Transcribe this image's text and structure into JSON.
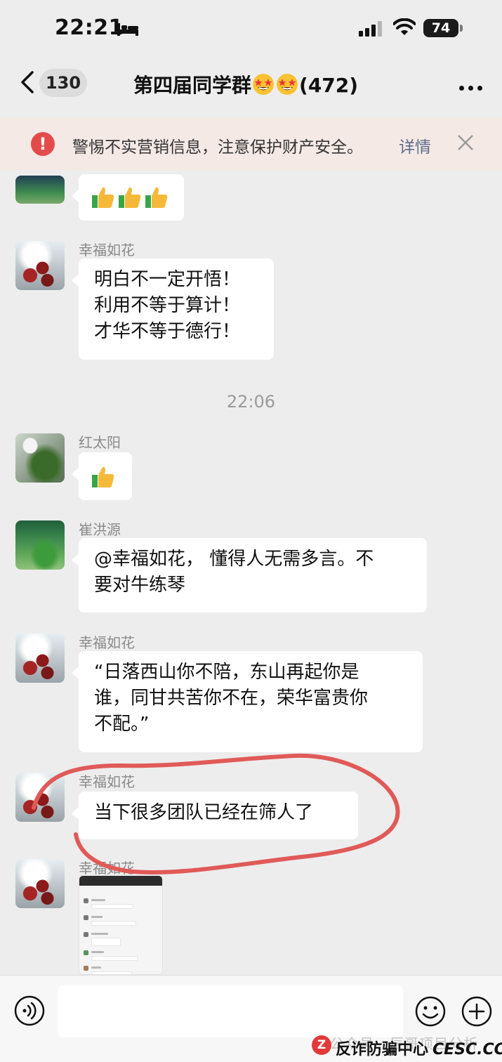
{
  "status_bar": {
    "time": "22:21",
    "battery": "74"
  },
  "nav": {
    "unread_count": "130",
    "group_name": "第四届同学群",
    "member_count": "(472)"
  },
  "warning": {
    "message": "警惕不实营销信息，注意保护财产安全。",
    "detail_link": "详情"
  },
  "messages": [
    {
      "sender": "幸福如花",
      "lines": [
        "明白不一定开悟！",
        "利用不等于算计！",
        "才华不等于德行！"
      ]
    },
    {
      "sender": "红太阳",
      "content": "thumbs-up-emoji"
    },
    {
      "sender": "崔洪源",
      "lines": [
        "@幸福如花， 懂得人无需多言。不",
        "要对牛练琴"
      ]
    },
    {
      "sender": "幸福如花",
      "lines": [
        "“日落西山你不陪，东山再起你是",
        "谁，同甘共苦你不在，荣华富贵你",
        "不配。”"
      ]
    },
    {
      "sender": "幸福如花",
      "lines": [
        "当下很多团队已经在筛人了"
      ]
    },
    {
      "sender": "幸福如花",
      "content": "screenshot-image"
    }
  ],
  "timestamp": "22:06",
  "top_message": {
    "content": "thumbs-up-x3"
  },
  "input": {
    "placeholder": ""
  },
  "watermark": {
    "faint": "公众号 · 辰哥项目分析",
    "logo_letter": "Z",
    "center": "反诈防骗中心",
    "site": "CESC.CC"
  },
  "colors": {
    "background": "#ededed",
    "bubble": "#ffffff",
    "warning_bg": "#f5e9e6",
    "warning_icon": "#e34b4b",
    "link": "#5e6d8a",
    "annotation_loop": "#e05a58"
  }
}
